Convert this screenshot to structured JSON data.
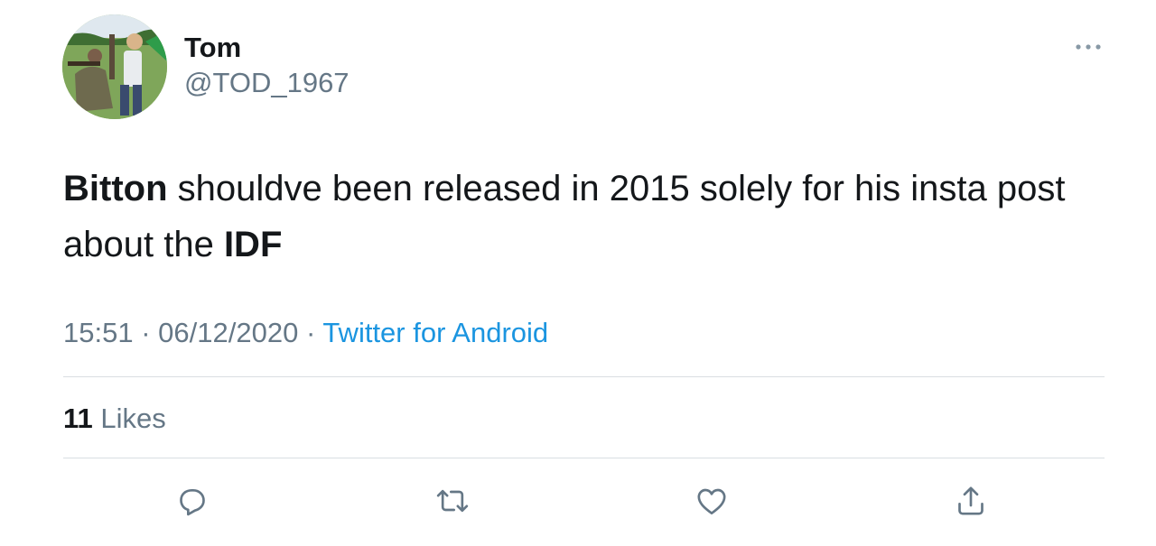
{
  "author": {
    "display_name": "Tom",
    "handle": "@TOD_1967",
    "avatar_icon": "profile-photo"
  },
  "tweet": {
    "segments": [
      {
        "text": "Bitton",
        "bold": true
      },
      {
        "text": " shouldve been released in 2015 solely for his insta post about the ",
        "bold": false
      },
      {
        "text": "IDF",
        "bold": true
      }
    ],
    "time": "15:51",
    "date": "06/12/2020",
    "separator": "·",
    "source": "Twitter for Android"
  },
  "stats": {
    "likes_count": "11",
    "likes_label": "Likes"
  },
  "actions": [
    {
      "name": "reply",
      "icon": "reply-icon"
    },
    {
      "name": "retweet",
      "icon": "retweet-icon"
    },
    {
      "name": "like",
      "icon": "heart-icon"
    },
    {
      "name": "share",
      "icon": "share-icon"
    }
  ],
  "more_icon": "more-horizontal-icon",
  "colors": {
    "text": "#14171a",
    "secondary": "#657786",
    "link": "#1b95e0",
    "divider": "#d9dee2"
  }
}
